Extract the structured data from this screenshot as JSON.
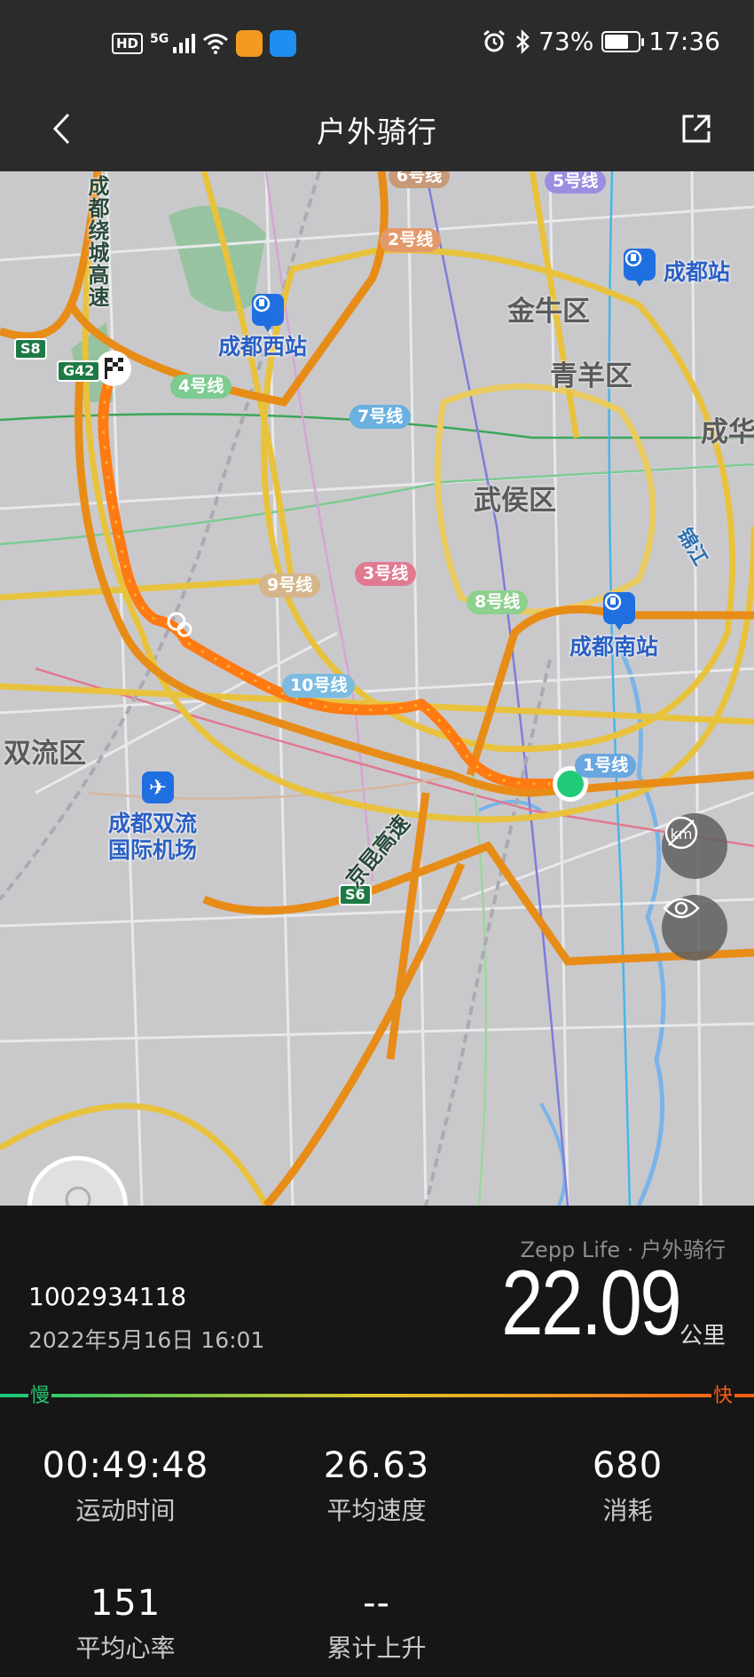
{
  "status_bar": {
    "hd": "HD",
    "network": "5G",
    "battery": "73%",
    "battery_level": 0.73,
    "time": "17:36",
    "icons": [
      "hd-icon",
      "signal-icon",
      "wifi-icon",
      "app-icon",
      "app-icon",
      "alarm-icon",
      "bluetooth-icon",
      "battery-icon"
    ]
  },
  "header": {
    "title": "户外骑行",
    "back_icon": "chevron-left-icon",
    "share_icon": "share-icon"
  },
  "map": {
    "districts": [
      "金牛区",
      "青羊区",
      "武侯区",
      "双流区",
      "成华"
    ],
    "stations": [
      "成都西站",
      "成都站",
      "成都南站"
    ],
    "airport": [
      "成都双流",
      "国际机场"
    ],
    "roads": [
      "成都绕城高速",
      "京昆高速",
      "锦江"
    ],
    "shields": [
      "S8",
      "G42",
      "S6"
    ],
    "metro_lines": [
      "6号线",
      "5号线",
      "2号线",
      "4号线",
      "7号线",
      "9号线",
      "3号线",
      "8号线",
      "10号线",
      "1号线"
    ],
    "route_color": "#ff7a12",
    "start_color": "#1fcb77",
    "buttons": [
      "hide-distance-icon",
      "eye-icon"
    ]
  },
  "workout": {
    "source": "Zepp Life · 户外骑行",
    "user_id": "1002934118",
    "datetime": "2022年5月16日 16:01",
    "distance": "22.09",
    "distance_unit": "公里",
    "speed_slow": "慢",
    "speed_fast": "快",
    "stats": [
      {
        "value": "00:49:48",
        "label": "运动时间"
      },
      {
        "value": "26.63",
        "label": "平均速度"
      },
      {
        "value": "680",
        "label": "消耗"
      },
      {
        "value": "151",
        "label": "平均心率"
      },
      {
        "value": "--",
        "label": "累计上升"
      }
    ]
  }
}
